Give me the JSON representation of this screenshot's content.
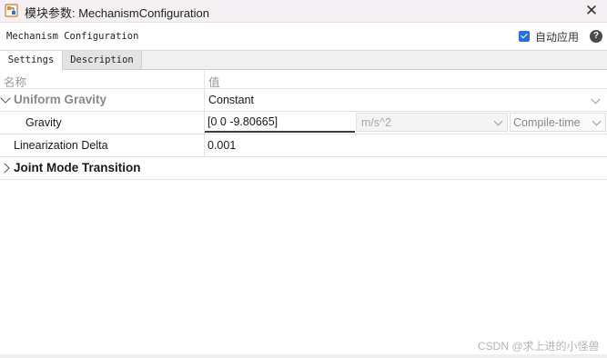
{
  "window": {
    "title": "模块参数: MechanismConfiguration",
    "close_glyph": "✕"
  },
  "header": {
    "block_title": "Mechanism Configuration",
    "auto_apply_label": "自动应用",
    "auto_apply_checked": true,
    "help_glyph": "?"
  },
  "tabs": [
    {
      "label": "Settings",
      "active": true
    },
    {
      "label": "Description",
      "active": false
    }
  ],
  "columns": {
    "name": "名称",
    "value": "值"
  },
  "rows": {
    "uniform_gravity": {
      "label": "Uniform Gravity",
      "value": "Constant",
      "expanded": true
    },
    "gravity": {
      "label": "Gravity",
      "value": "[0 0 -9.80665]",
      "unit": "m/s^2",
      "eval_mode": "Compile-time"
    },
    "linearization_delta": {
      "label": "Linearization Delta",
      "value": "0.001"
    },
    "joint_mode_transition": {
      "label": "Joint Mode Transition",
      "expanded": false
    }
  },
  "watermark": "CSDN @求上进的小怪兽",
  "colors": {
    "accent": "#2a6fd6",
    "title_bg": "#f5f0f3",
    "tab_bg": "#f0f0f0"
  }
}
